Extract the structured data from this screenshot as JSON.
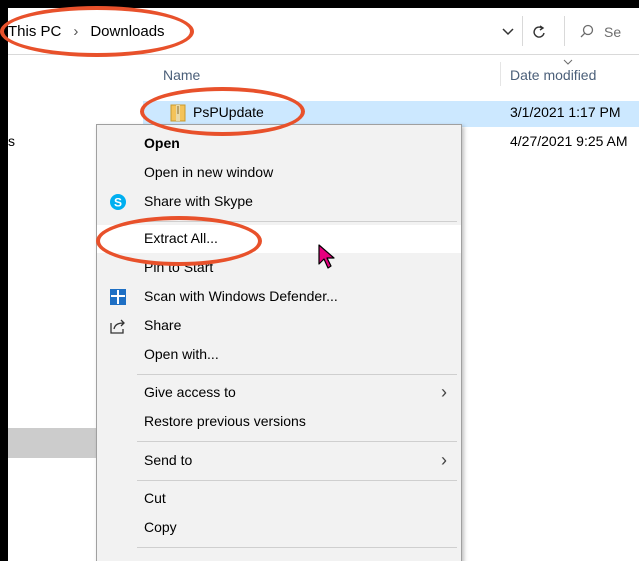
{
  "address_bar": {
    "crumbs": [
      "This PC",
      "Downloads"
    ],
    "separator": "›",
    "search_placeholder": "Se"
  },
  "columns": {
    "name": "Name",
    "date_modified": "Date modified"
  },
  "left_pane": {
    "partial_text": "s"
  },
  "files": [
    {
      "name": "PsPUpdate",
      "date": "3/1/2021 1:17 PM",
      "selected": true,
      "icon": "zip-folder-icon"
    },
    {
      "name": "",
      "date": "4/27/2021 9:25 AM",
      "selected": false
    }
  ],
  "context_menu": {
    "items": [
      {
        "label": "Open",
        "bold": true
      },
      {
        "label": "Open in new window"
      },
      {
        "label": "Share with Skype",
        "icon": "skype-icon"
      },
      {
        "label": "Extract All...",
        "highlighted": true
      },
      {
        "label": "Pin to Start"
      },
      {
        "label": "Scan with Windows Defender...",
        "icon": "windows-defender-icon"
      },
      {
        "label": "Share",
        "icon": "share-icon"
      },
      {
        "label": "Open with..."
      },
      {
        "label": "Give access to",
        "submenu": true
      },
      {
        "label": "Restore previous versions"
      },
      {
        "label": "Send to",
        "submenu": true
      },
      {
        "label": "Cut"
      },
      {
        "label": "Copy"
      }
    ],
    "submenu_arrow": "›"
  },
  "colors": {
    "annotation": "#e8512b",
    "selection": "#cce8ff",
    "menu_bg": "#f2f2f2",
    "cursor": "#e6007e"
  }
}
